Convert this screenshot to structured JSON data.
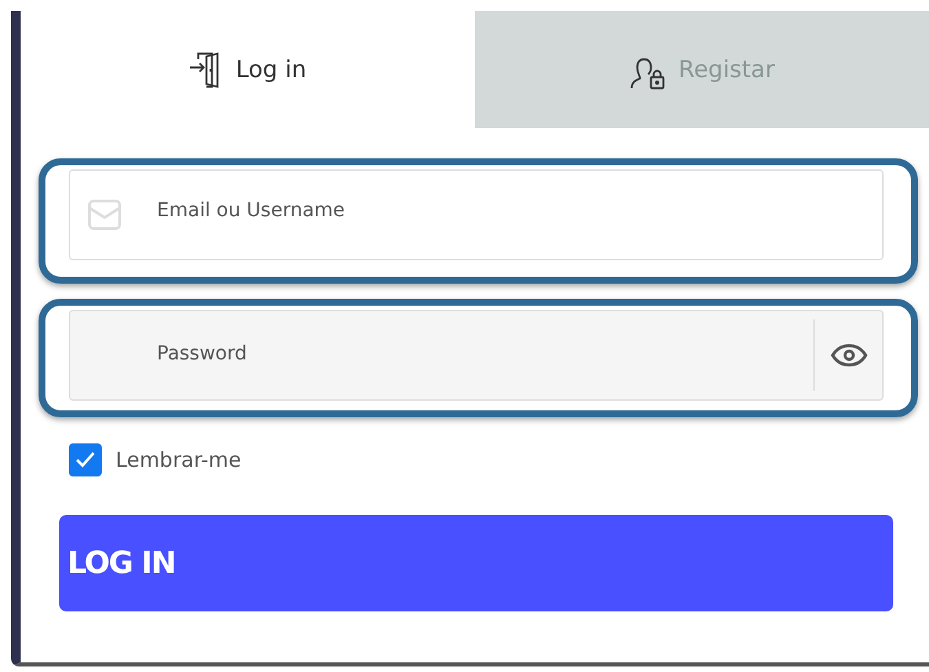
{
  "tabs": [
    {
      "label": "Log in",
      "kind": "login",
      "selected": true
    },
    {
      "label": "Registar",
      "kind": "register",
      "selected": false
    }
  ],
  "email_field": {
    "placeholder": "Email ou Username"
  },
  "password_field": {
    "placeholder": "Password"
  },
  "remember": {
    "label": "Lembrar-me",
    "checked": true
  },
  "submit_button": "LOG IN"
}
